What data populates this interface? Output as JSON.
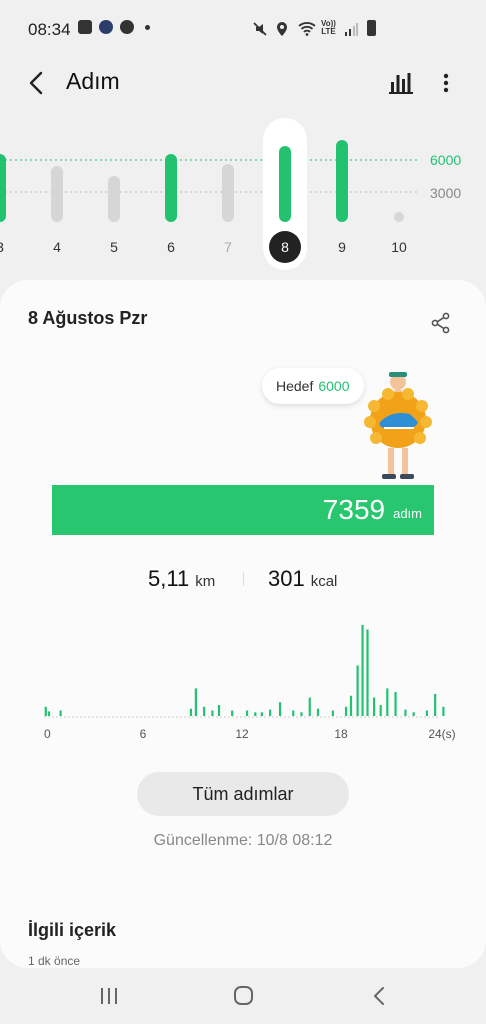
{
  "status_bar": {
    "time": "08:34",
    "left_icons": [
      "image-icon",
      "messenger-icon",
      "accessibility-icon",
      "notification-dot-icon"
    ],
    "right_icons": [
      "mute-icon",
      "location-icon",
      "wifi-icon",
      "volte-icon",
      "signal-icon",
      "battery-icon"
    ],
    "lte_top": "Vo))",
    "lte_bottom": "LTE"
  },
  "app_bar": {
    "title": "Adım",
    "back_icon": "back-arrow-icon",
    "chart_icon": "bar-chart-icon",
    "more_icon": "more-vert-icon"
  },
  "week_strip": {
    "days": [
      {
        "label": "3",
        "steps_state": "goal-met"
      },
      {
        "label": "4",
        "steps_state": "below-goal"
      },
      {
        "label": "5",
        "steps_state": "below-goal"
      },
      {
        "label": "6",
        "steps_state": "goal-met"
      },
      {
        "label": "7",
        "steps_state": "below-goal"
      },
      {
        "label": "8",
        "steps_state": "goal-met",
        "selected": true
      },
      {
        "label": "9",
        "steps_state": "goal-met"
      },
      {
        "label": "10",
        "steps_state": "empty"
      }
    ],
    "goal_line_label": "6000",
    "mid_line_label": "3000",
    "goal_color": "#22c271",
    "below_color": "#d6d6d6"
  },
  "day_card": {
    "date": "8 Ağustos Pzr",
    "share_icon": "share-icon",
    "goal_label": "Hedef",
    "goal_value": "6000",
    "mascot_icon": "running-shoe-mascot-icon",
    "steps_value": "7359",
    "steps_unit": "adım",
    "progress_ratio": 1.0,
    "distance_value": "5,11",
    "distance_unit": "km",
    "calories_value": "301",
    "calories_unit": "kcal",
    "all_steps_button": "Tüm adımlar",
    "updated_text": "Güncellenme: 10/8 08:12",
    "accent_color": "#28c76f"
  },
  "chart_data": {
    "type": "bar",
    "x_ticks": [
      "0",
      "6",
      "12",
      "18",
      "24(s)"
    ],
    "x_range": [
      0,
      24
    ],
    "values_relative": [
      [
        0.1,
        0.1
      ],
      [
        0.3,
        0.05
      ],
      [
        1.0,
        0.06
      ],
      [
        8.9,
        0.08
      ],
      [
        9.2,
        0.3
      ],
      [
        9.7,
        0.1
      ],
      [
        10.2,
        0.06
      ],
      [
        10.6,
        0.12
      ],
      [
        11.4,
        0.06
      ],
      [
        12.3,
        0.06
      ],
      [
        12.8,
        0.04
      ],
      [
        13.2,
        0.04
      ],
      [
        13.7,
        0.07
      ],
      [
        14.3,
        0.15
      ],
      [
        15.1,
        0.06
      ],
      [
        15.6,
        0.04
      ],
      [
        16.1,
        0.2
      ],
      [
        16.6,
        0.08
      ],
      [
        17.5,
        0.06
      ],
      [
        18.3,
        0.1
      ],
      [
        18.6,
        0.22
      ],
      [
        19.0,
        0.55
      ],
      [
        19.3,
        0.99
      ],
      [
        19.6,
        0.94
      ],
      [
        20.0,
        0.2
      ],
      [
        20.4,
        0.12
      ],
      [
        20.8,
        0.3
      ],
      [
        21.3,
        0.26
      ],
      [
        21.9,
        0.07
      ],
      [
        22.4,
        0.04
      ],
      [
        23.2,
        0.06
      ],
      [
        23.7,
        0.24
      ],
      [
        24.2,
        0.1
      ]
    ],
    "bar_color": "#22c271"
  },
  "related": {
    "title": "İlgili içerik",
    "time": "1 dk önce"
  },
  "nav_bar": {
    "recents_icon": "recents-icon",
    "home_icon": "home-icon",
    "back_icon": "nav-back-icon"
  }
}
